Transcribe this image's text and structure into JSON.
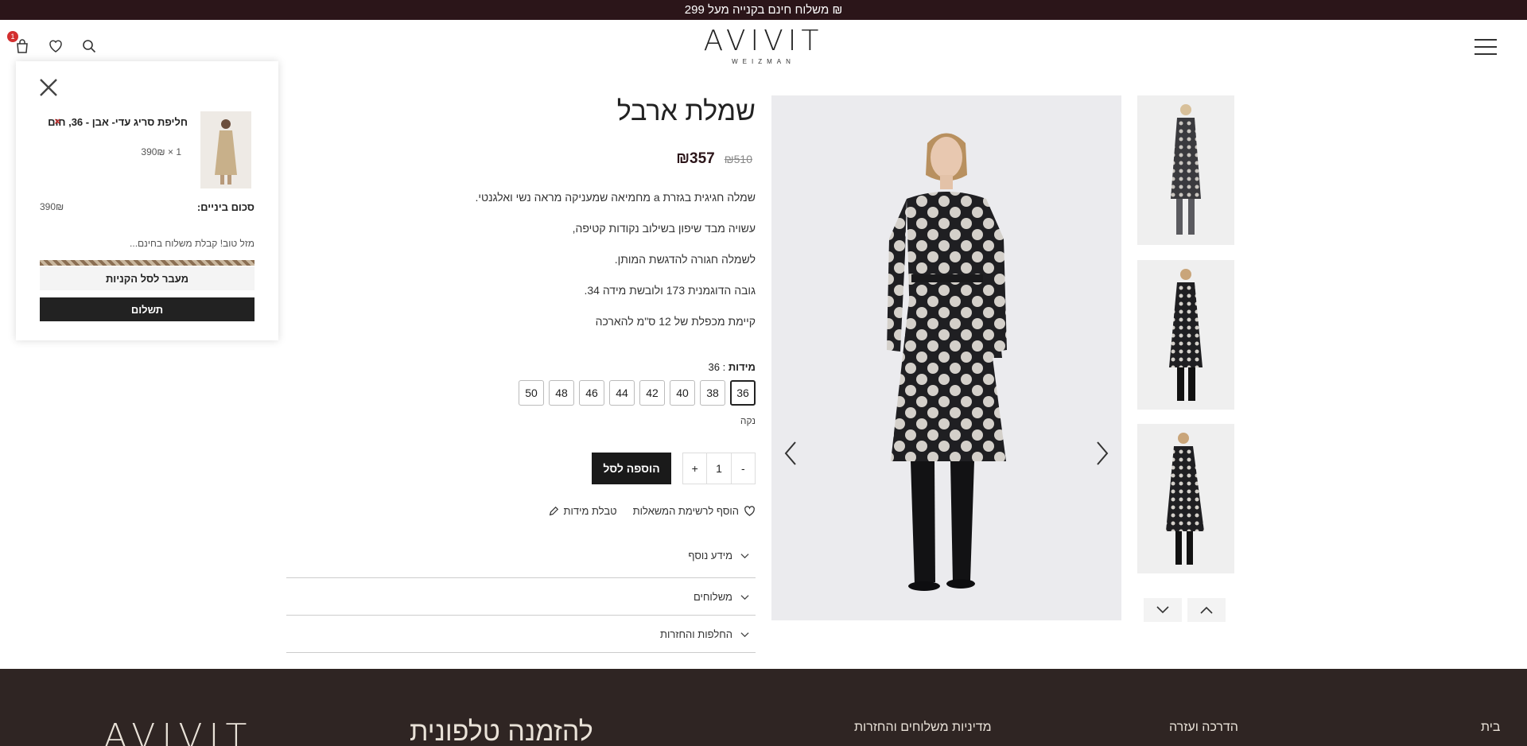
{
  "topbar": {
    "text": "משלוח חינם בקנייה מעל 299 ₪"
  },
  "brand": {
    "name": "AVIVIT",
    "sub": "WEIZMAN"
  },
  "header": {
    "cart_count": "1"
  },
  "minicart": {
    "item_name": "חליפת סריג עדי- אבן - 36, חום",
    "remove": "×",
    "item_qty": "1 × 390₪",
    "subtotal_label": "סכום ביניים:",
    "subtotal_value": "390₪",
    "free_shipping_msg": "מזל טוב! קבלת משלוח בחינם...",
    "view_cart": "מעבר לסל הקניות",
    "checkout": "תשלום"
  },
  "product": {
    "title": "שמלת ארבל",
    "price_old": "₪510",
    "price_new": "₪357",
    "description": [
      "שמלה חגיגית בגזרת a מחמיאה שמעניקה מראה נשי ואלגנטי.",
      "עשויה מבד שיפון בשילוב נקודות קטיפה,",
      "לשמלה חגורה להדגשת המותן.",
      "גובה הדוגמנית 173 ולובשת מידה 34.",
      "קיימת מכפלת של 12 ס\"מ להארכה"
    ],
    "sizes_label": "מידות",
    "selected_size": ": 36",
    "sizes": [
      "36",
      "38",
      "40",
      "42",
      "44",
      "46",
      "48",
      "50"
    ],
    "clear": "נקה",
    "qty_minus": "-",
    "qty_value": "1",
    "qty_plus": "+",
    "add_to_cart": "הוספה לסל",
    "wishlist": "הוסף לרשימת המשאלות",
    "size_chart": "טבלת מידות",
    "accordion": [
      "מידע נוסף",
      "משלוחים",
      "החלפות והחזרות"
    ]
  },
  "footer": {
    "brand": "AVIVIT",
    "heading_orders": "להזמנה טלפונית",
    "heading_policy": "מדיניות משלוחים והחזרות",
    "heading_guide": "הדרכה ועזרה",
    "heading_home": "בית"
  },
  "colors": {
    "topbar": "#2b1519",
    "footer": "#2f2523",
    "accent": "#2b1519"
  }
}
